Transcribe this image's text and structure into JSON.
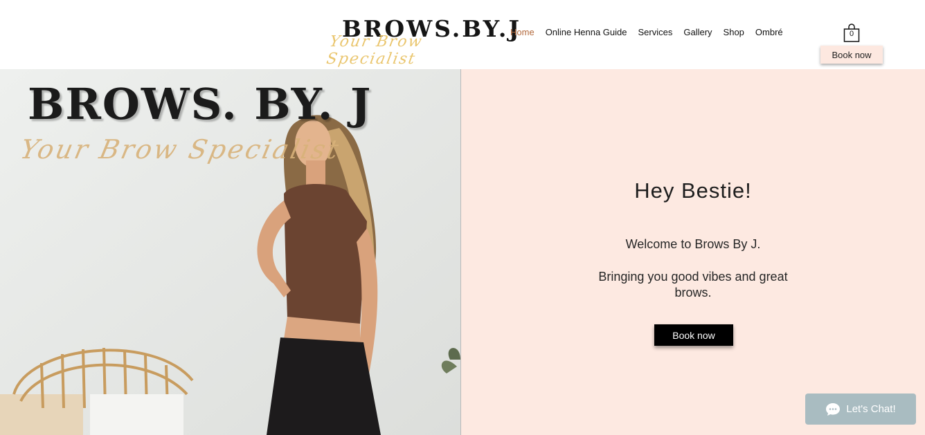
{
  "header": {
    "logo_main": "BROWS.BY.J",
    "logo_script": "Your Brow Specialist",
    "nav": [
      {
        "label": "Home",
        "active": true
      },
      {
        "label": "Online Henna Guide"
      },
      {
        "label": "Services"
      },
      {
        "label": "Gallery"
      },
      {
        "label": "Shop"
      },
      {
        "label": "Ombré"
      }
    ],
    "cart_count": "0",
    "book_label": "Book now"
  },
  "hero": {
    "sign_text": "BROWS. BY. J",
    "sign_script": "Your Brow Specialist",
    "title": "Hey Bestie!",
    "welcome": "Welcome to Brows By J.",
    "tagline": "Bringing you good vibes and great brows.",
    "book_label": "Book now"
  },
  "chat": {
    "label": "Let's Chat!"
  },
  "colors": {
    "panel_bg": "#fde9e1",
    "accent": "#b36a3d",
    "chat_bg": "#a9bcc1"
  }
}
